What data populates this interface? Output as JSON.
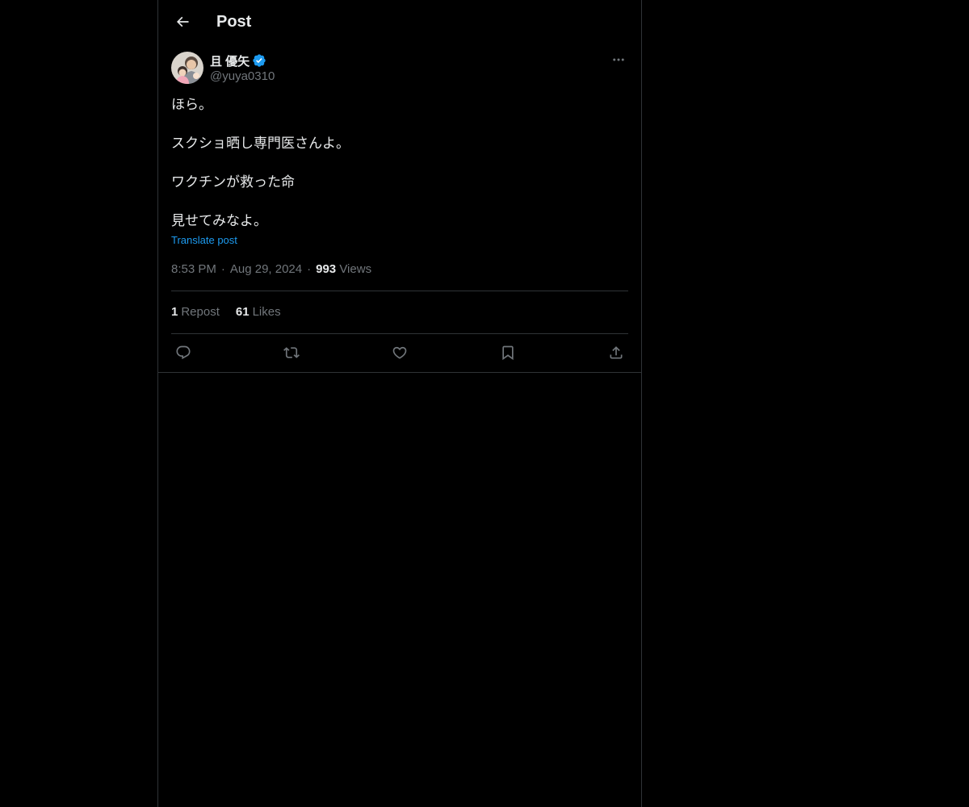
{
  "header": {
    "title": "Post",
    "back_icon": "arrow-left-icon"
  },
  "author": {
    "display_name": "且 優矢",
    "verified": true,
    "verified_color": "#1d9bf0",
    "handle": "@yuya0310"
  },
  "post": {
    "lines": [
      "ほら。",
      "スクショ晒し専門医さんよ。",
      "ワクチンが救った命",
      "見せてみなよ。"
    ],
    "translate_label": "Translate post",
    "time": "8:53 PM",
    "date": "Aug 29, 2024",
    "separator": "·",
    "views_count": "993",
    "views_label": "Views"
  },
  "stats": {
    "reposts_count": "1",
    "reposts_label": "Repost",
    "likes_count": "61",
    "likes_label": "Likes"
  },
  "actions": {
    "icons": [
      "reply-icon",
      "repost-icon",
      "like-icon",
      "bookmark-icon",
      "share-icon"
    ]
  },
  "colors": {
    "background": "#000000",
    "text_primary": "#e7e9ea",
    "text_secondary": "#71767b",
    "accent": "#1d9bf0",
    "border": "#2f3336"
  }
}
